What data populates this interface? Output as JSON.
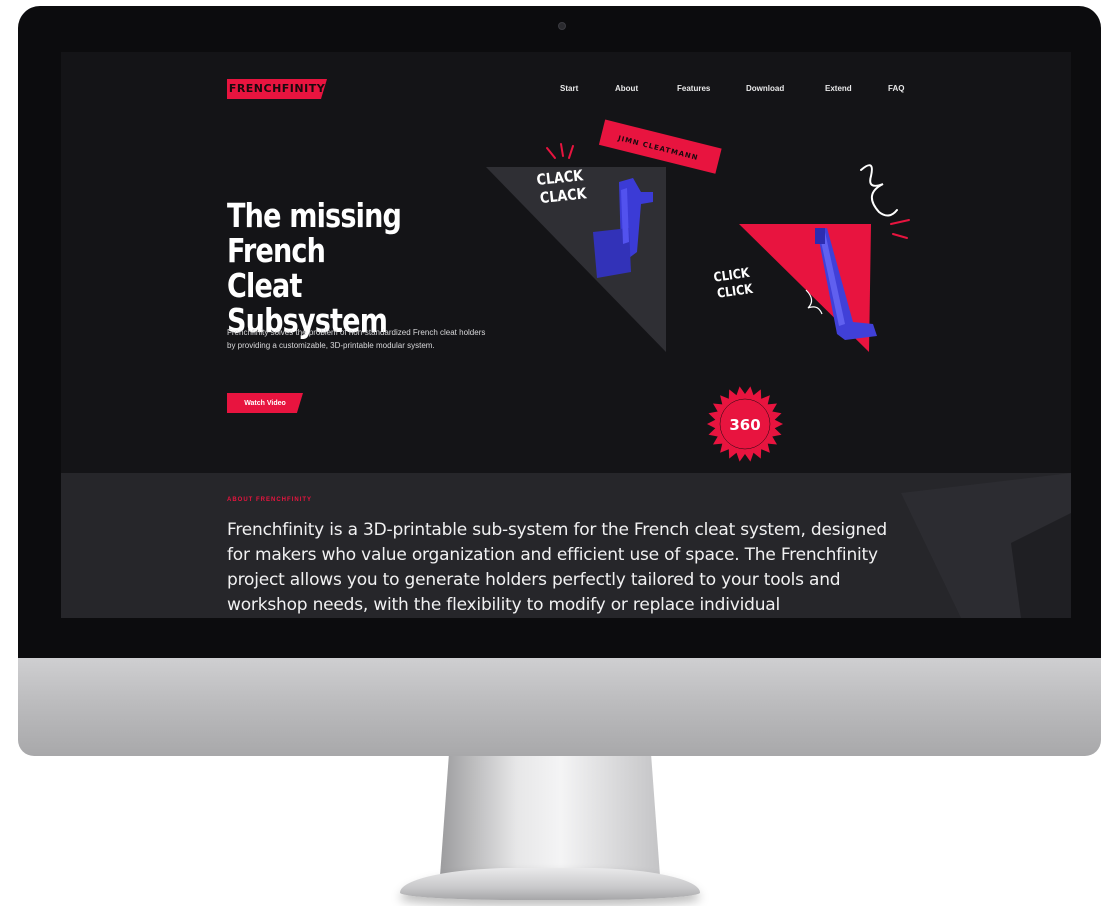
{
  "brand": {
    "logo_text": "FRENCHFINITY",
    "accent_color": "#e8143f",
    "dark_bg": "#141417",
    "secondary_color": "#3a3ad0"
  },
  "nav": {
    "items": [
      {
        "label": "Start"
      },
      {
        "label": "About"
      },
      {
        "label": "Features"
      },
      {
        "label": "Download"
      },
      {
        "label": "Extend"
      },
      {
        "label": "FAQ"
      }
    ]
  },
  "hero": {
    "title_line1": "The missing",
    "title_line2": "French Cleat",
    "title_line3": "Subsystem",
    "description": "Frenchfinity solves the problem of non-standardized French cleat holders by providing a customizable, 3D-printable modular system.",
    "button_label": "Watch Video"
  },
  "illustration": {
    "clack_line1": "CLACK",
    "clack_line2": "CLACK",
    "tag_text": "JIMN CLEATMANN",
    "click_line1": "CLICK",
    "click_line2": "CLICK",
    "badge_text": "360"
  },
  "about": {
    "eyebrow": "ABOUT FRENCHFINITY",
    "text": "Frenchfinity is a 3D-printable sub-system for the French cleat system, designed for makers who value organization and efficient use of space. The Frenchfinity project allows you to generate holders perfectly tailored to your tools and workshop needs, with the flexibility to modify or replace individual"
  }
}
